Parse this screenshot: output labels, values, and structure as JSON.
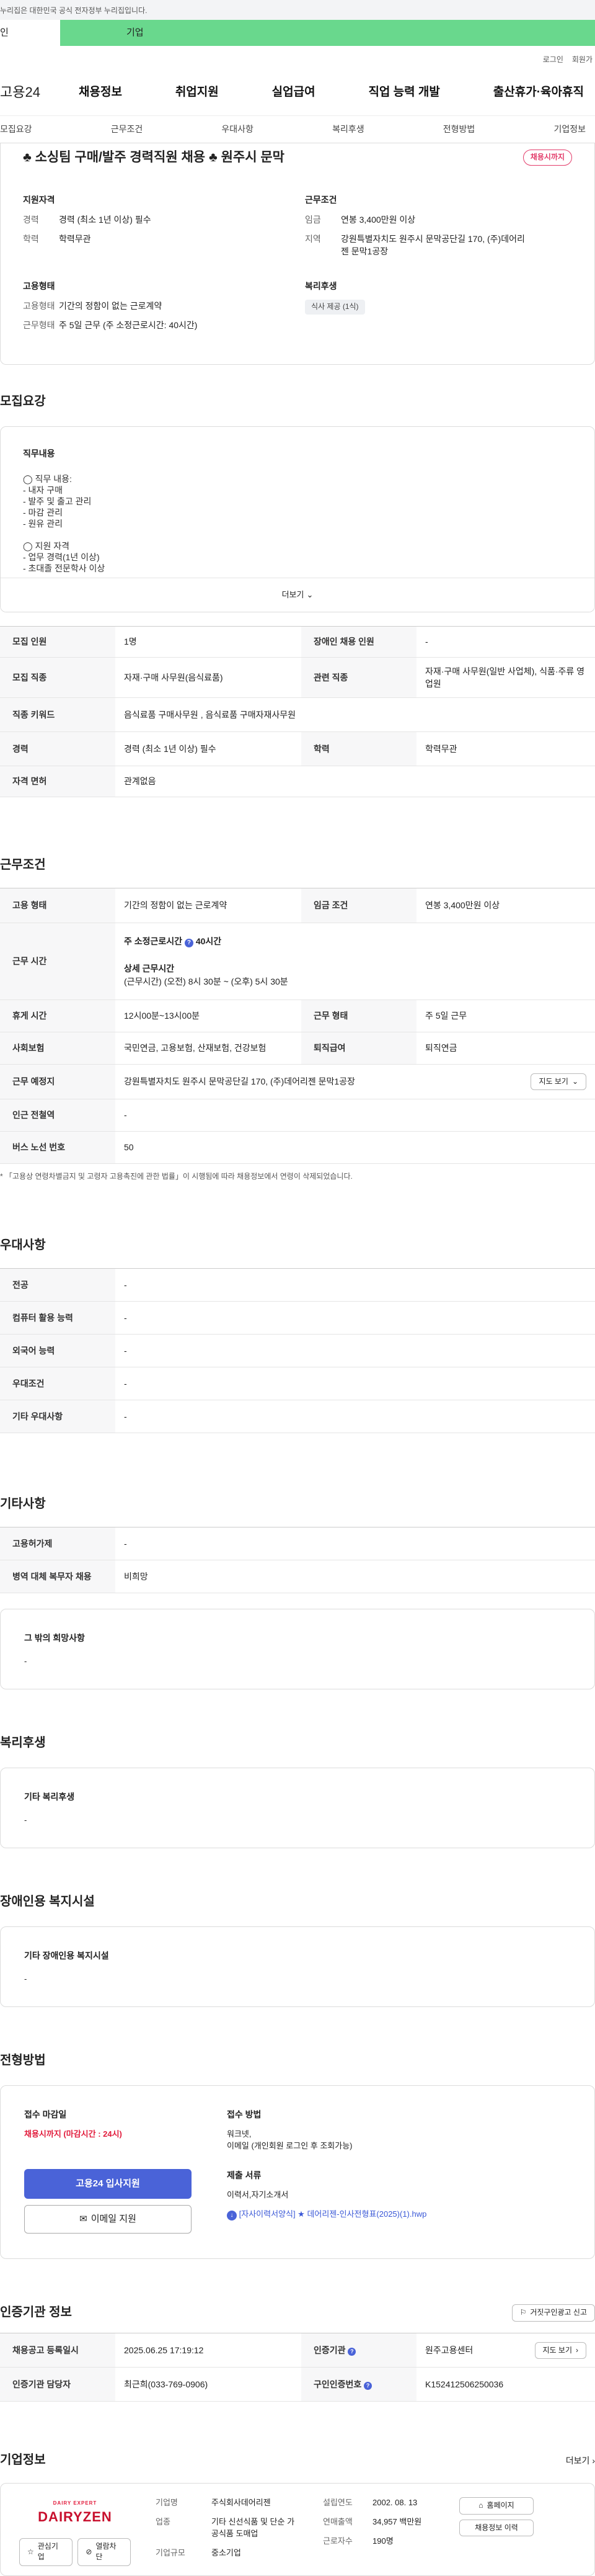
{
  "gov_notice": "누리집은 대한민국 공식 전자정부 누리집입니다.",
  "portal_tabs": [
    "인",
    "기업"
  ],
  "util_links": [
    "로그인",
    "회원가"
  ],
  "logo": "고용24",
  "gnb": [
    "채용정보",
    "취업지원",
    "실업급여",
    "직업 능력 개발",
    "출산휴가·육아휴직"
  ],
  "anchor_tabs": [
    "모집요강",
    "근무조건",
    "우대사항",
    "복리후생",
    "전형방법",
    "기업정보"
  ],
  "job": {
    "title": "♣ 소싱팀 구매/발주 경력직원 채용 ♣ 원주시 문막",
    "status_badge": "채용시까지",
    "summary": {
      "qual_heading": "지원자격",
      "qual": [
        {
          "k": "경력",
          "v": "경력 (최소 1년 이상) 필수"
        },
        {
          "k": "학력",
          "v": "학력무관"
        }
      ],
      "cond_heading": "근무조건",
      "cond": [
        {
          "k": "임금",
          "v": "연봉 3,400만원 이상"
        },
        {
          "k": "지역",
          "v": "강원특별자치도 원주시 문막공단길 170, (주)데어리젠 문막1공장"
        }
      ],
      "emp_heading": "고용형태",
      "emp": [
        {
          "k": "고용형태",
          "v": "기간의 정함이 없는 근로계약"
        },
        {
          "k": "근무형태",
          "v": "주 5일 근무 (주 소정근로시간: 40시간)"
        }
      ],
      "welfare_heading": "복리후생",
      "welfare_chip": "식사 제공 (1식)"
    }
  },
  "recruit": {
    "heading": "모집요강",
    "duty_heading": "직무내용",
    "duty_lines": [
      "◯ 직무 내용:",
      "- 내자 구매",
      "- 발주 및 출고 관리",
      "- 마감 관리",
      "- 원유 관리",
      "",
      "◯ 지원 자격",
      "- 업무 경력(1년 이상)",
      "- 초대졸 전문학사 이상"
    ],
    "more": "더보기",
    "rows": [
      {
        "k1": "모집 인원",
        "v1": "1명",
        "k2": "장애인 채용 인원",
        "v2": "-"
      },
      {
        "k1": "모집 직종",
        "v1": "자재·구매 사무원(음식료품)",
        "k2": "관련 직종",
        "v2": "자재·구매 사무원(일반 사업체), 식품·주류 영업원"
      },
      {
        "k1": "직종 키워드",
        "v1": "음식료품 구매사무원 , 음식료품 구매자재사무원",
        "k2": "",
        "v2": ""
      },
      {
        "k1": "경력",
        "v1": "경력 (최소 1년 이상) 필수",
        "k2": "학력",
        "v2": "학력무관"
      },
      {
        "k1": "자격 면허",
        "v1": "관계없음",
        "k2": "",
        "v2": ""
      }
    ]
  },
  "work": {
    "heading": "근무조건",
    "emp_k": "고용 형태",
    "emp_v": "기간의 정함이 없는 근로계약",
    "wage_k": "임금 조건",
    "wage_v": "연봉 3,400만원 이상",
    "time_k": "근무 시간",
    "time_weekly": "주 소정근로시간",
    "time_weekly_v": "40시간",
    "time_detail_h": "상세 근무시간",
    "time_detail": "(근무시간) (오전) 8시 30분 ~ (오후) 5시 30분",
    "break_k": "휴게 시간",
    "break_v": "12시00분~13시00분",
    "form_k": "근무 형태",
    "form_v": "주 5일 근무",
    "ins_k": "사회보험",
    "ins_v": "국민연금, 고용보험, 산재보험, 건강보험",
    "ret_k": "퇴직급여",
    "ret_v": "퇴직연금",
    "place_k": "근무 예정지",
    "place_v": "강원특별자치도 원주시 문막공단길 170, (주)데어리젠 문막1공장",
    "map_btn": "지도 보기",
    "sub_k": "인근 전철역",
    "sub_v": "-",
    "bus_k": "버스 노선 번호",
    "bus_v": "50",
    "note": "「고용상 연령차별금지 및 고령자 고용촉진에 관한 법률」이 시행됨에 따라 채용정보에서 연령이 삭제되었습니다."
  },
  "pref": {
    "heading": "우대사항",
    "rows": [
      {
        "k": "전공",
        "v": "-"
      },
      {
        "k": "컴퓨터 활용 능력",
        "v": "-"
      },
      {
        "k": "외국어 능력",
        "v": "-"
      },
      {
        "k": "우대조건",
        "v": "-"
      },
      {
        "k": "기타 우대사항",
        "v": "-"
      }
    ]
  },
  "etc": {
    "heading": "기타사항",
    "rows": [
      {
        "k": "고용허가제",
        "v": "-"
      },
      {
        "k": "병역 대체 복무자 채용",
        "v": "비희망"
      }
    ],
    "other_h": "그 밖의 희망사항",
    "other_v": "-"
  },
  "benefit": {
    "heading": "복리후생",
    "box_h": "기타 복리후생",
    "box_v": "-"
  },
  "disabled": {
    "heading": "장애인용 복지시설",
    "box_h": "기타 장애인용 복지시설",
    "box_v": "-"
  },
  "apply": {
    "heading": "전형방법",
    "deadline_h": "접수 마감일",
    "deadline_v": "채용시까지 (마감시간 : 24시)",
    "apply_btn": "고용24 입사지원",
    "email_btn": "이메일 지원",
    "method_h": "접수 방법",
    "method_v1": "워크넷,",
    "method_v2": "이메일 (개인회원 로그인 후 조회가능)",
    "docs_h": "제출 서류",
    "docs_v": "이력서,자기소개서",
    "file": "[자사이력서양식] ★ 데어리젠-인사전형표(2025)(1).hwp"
  },
  "cert": {
    "heading": "인증기관 정보",
    "report_btn": "거짓구인광고 신고",
    "reg_k": "채용공고 등록일시",
    "reg_v": "2025.06.25 17:19:12",
    "org_k": "인증기관",
    "org_v": "원주고용센터",
    "map_btn": "지도 보기",
    "mgr_k": "인증기관 담당자",
    "mgr_v": "최근희(033-769-0906)",
    "id_k": "구인인증번호",
    "id_v": "K152412506250036"
  },
  "company": {
    "heading": "기업정보",
    "more": "더보기",
    "logo_top": "DAIRY EXPERT",
    "logo_name": "DAIRYZEN",
    "fav_btn": "관심기업",
    "block_btn": "열람차단",
    "name_k": "기업명",
    "name_v": "주식회사데어리젠",
    "ind_k": "업종",
    "ind_v": "기타 신선식품 및 단순 가공식품 도매업",
    "size_k": "기업규모",
    "size_v": "중소기업",
    "est_k": "설립연도",
    "est_v": "2002. 08. 13",
    "sales_k": "연매출액",
    "sales_v": "34,957 백만원",
    "emp_k": "근로자수",
    "emp_v": "190명",
    "home_btn": "홈페이지",
    "jobs_btn": "채용정보 이력"
  },
  "colors": {
    "primary": "#4a63d8",
    "accent_green": "#69d88d",
    "deadline_red": "#e21c3c",
    "badge_pink": "#e33c6a"
  }
}
